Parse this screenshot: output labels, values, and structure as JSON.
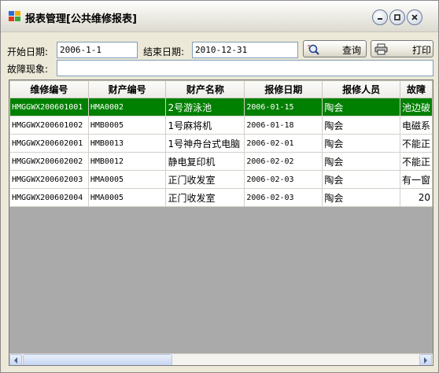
{
  "window": {
    "title": "报表管理[公共维修报表]",
    "app_icon": "report-app-icon",
    "buttons": [
      "minimize-icon",
      "restore-icon",
      "close-icon"
    ]
  },
  "filters": {
    "start_date_label": "开始日期:",
    "start_date_value": "2006-1-1",
    "end_date_label": "结束日期:",
    "end_date_value": "2010-12-31",
    "fault_label": "故障现象:",
    "fault_value": "",
    "query_label": "查询",
    "print_label": "打印"
  },
  "table": {
    "columns": [
      "维修编号",
      "财产编号",
      "财产名称",
      "报修日期",
      "报修人员",
      "故障"
    ],
    "rows": [
      [
        "HMGGWX200601001",
        "HMA0002",
        "2号游泳池",
        "2006-01-15",
        "陶会",
        "池边破",
        true
      ],
      [
        "HMGGWX200601002",
        "HMB0005",
        "1号麻将机",
        "2006-01-18",
        "陶会",
        "电磁系",
        false
      ],
      [
        "HMGGWX200602001",
        "HMB0013",
        "1号神舟台式电脑",
        "2006-02-01",
        "陶会",
        "不能正",
        false
      ],
      [
        "HMGGWX200602002",
        "HMB0012",
        "静电复印机",
        "2006-02-02",
        "陶会",
        "不能正",
        false
      ],
      [
        "HMGGWX200602003",
        "HMA0005",
        "正门收发室",
        "2006-02-03",
        "陶会",
        "有一窗",
        false
      ],
      [
        "HMGGWX200602004",
        "HMA0005",
        "正门收发室",
        "2006-02-03",
        "陶会",
        "20",
        false
      ]
    ]
  },
  "colors": {
    "selected_row": "#008000",
    "window_bg": "#ece9d8",
    "grid_bg": "#aaaaaa"
  }
}
